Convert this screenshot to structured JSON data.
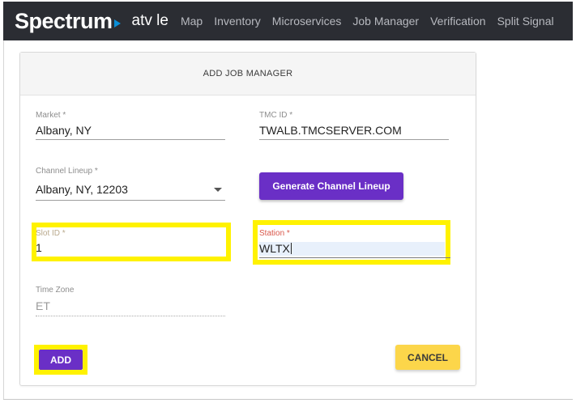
{
  "header": {
    "brand": "Spectrum",
    "app_name": "atv le",
    "nav": [
      "Map",
      "Inventory",
      "Microservices",
      "Job Manager",
      "Verification",
      "Split Signal"
    ]
  },
  "form": {
    "title": "ADD JOB MANAGER",
    "market": {
      "label": "Market *",
      "value": "Albany, NY"
    },
    "tmc_id": {
      "label": "TMC ID *",
      "value": "TWALB.TMCSERVER.COM"
    },
    "channel_lineup": {
      "label": "Channel Lineup *",
      "value": "Albany, NY, 12203"
    },
    "generate_button": "Generate Channel Lineup",
    "slot_id": {
      "label": "Slot ID *",
      "value": "1"
    },
    "station": {
      "label": "Station *",
      "value": "WLTX"
    },
    "time_zone": {
      "label": "Time Zone",
      "value": "ET"
    },
    "add_button": "ADD",
    "cancel_button": "CANCEL"
  },
  "colors": {
    "topbar": "#2b2d33",
    "brand_accent": "#0a8fd8",
    "primary_button": "#6a2fc6",
    "cancel_button": "#fcd64a",
    "highlight": "#fff200"
  }
}
